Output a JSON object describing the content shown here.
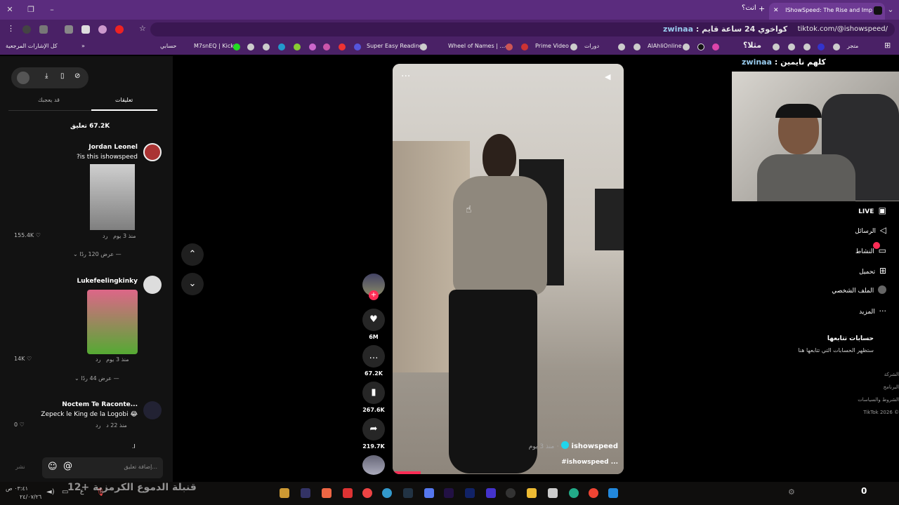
{
  "browser": {
    "tab_title": "IShowSpeed: The Rise and Imp",
    "tab_overlay_text": "انت؟",
    "url": "tiktok.com/@ishowspeed/",
    "url_overlay": "كواخوي 24 ساعة قايم :",
    "url_overlay_user": "zwinaa",
    "bookmarks": [
      "كل الإشارات المرجعية",
      "حسابي",
      "M7snEQ | Kick",
      "Super Easy Reading",
      "Wheel of Names | ...ب",
      "Prime Video",
      "دورات",
      "AlAhliOnline",
      "متجر"
    ],
    "bookmark_overlay": "مثلا؟"
  },
  "stream_overlay": {
    "label": "كلهم نايمين :",
    "user": "zwinaa"
  },
  "comments_panel": {
    "tab_comments": "تعليقات",
    "tab_maybe_like": "قد يعجبك",
    "count_label": "67.2K تعليق",
    "comments": [
      {
        "user": "Jordan Leonel",
        "text": "?is this ishowspeed",
        "time": "منذ 3 يوم",
        "reply": "رد",
        "likes": "155.4K",
        "replies": "عرض 120 ردًا"
      },
      {
        "user": "Lukefeelingkinky",
        "text": "",
        "time": "منذ 3 يوم",
        "reply": "رد",
        "likes": "14K",
        "replies": "عرض 44 ردًا"
      },
      {
        "user": "Noctem Te Raconte...",
        "text": "Zepeck le King de la Logobi 😂",
        "time": "منذ 22 د",
        "reply": "رد",
        "likes": "0",
        "replies": ""
      }
    ],
    "add_comment_placeholder": "إضافة تعليق...",
    "post_label": "نشر",
    "trailing_dot": ".ا"
  },
  "video": {
    "author": "ishowspeed",
    "time": "منذ 3 يوم",
    "caption": "#ishowspeed ...",
    "likes": "6M",
    "comments": "67.2K",
    "saves": "267.6K",
    "shares": "219.7K"
  },
  "right_nav": {
    "live": "LIVE",
    "messages": "الرسائل",
    "activity": "النشاط",
    "upload": "تحميل",
    "profile": "الملف الشخصي",
    "more": "المزيد",
    "following_title": "حسابات تتابعها",
    "following_sub": "ستظهر الحسابات التي تتابعها هنا",
    "footer": [
      "الشركة",
      "البرنامج",
      "الشروط والسياسات",
      "TikTok 2026 ©"
    ]
  },
  "taskbar": {
    "time": "٠٣:٤١ ص",
    "date": "٢٤/٠٧/٢٦",
    "overlay_text": "قنبلة الدموع الكرمزية +12",
    "lang": "ع",
    "right_num": "0"
  },
  "colors": {
    "browser_purple": "#5b2c7e",
    "tiktok_red": "#fe2c55",
    "verified": "#20d5ec"
  }
}
